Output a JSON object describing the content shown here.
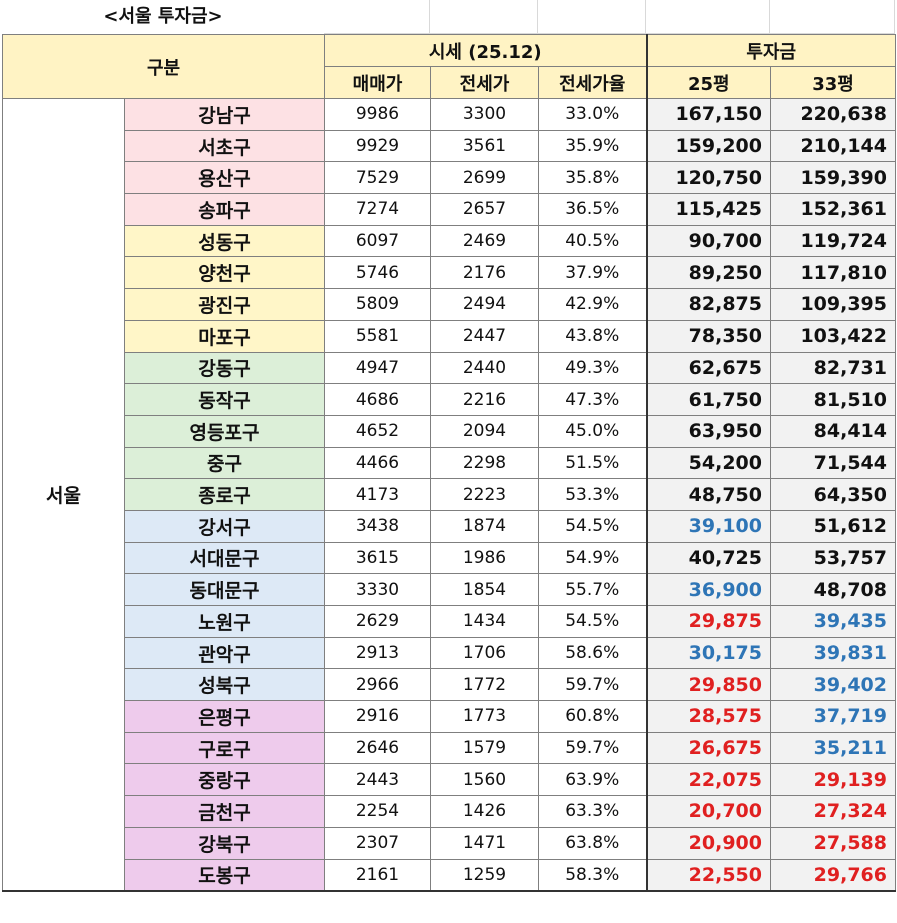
{
  "sheet_title": "<서울 투자금>",
  "header": {
    "category": "구분",
    "market_group": "시세 (25.12)",
    "investment_group": "투자금",
    "sale_price": "매매가",
    "jeonse_price": "전세가",
    "jeonse_ratio": "전세가율",
    "size_25": "25평",
    "size_33": "33평"
  },
  "region": "서울",
  "colors": {
    "pink": "#fde1e4",
    "yellow": "#fff6c8",
    "green": "#dcefd8",
    "blue": "#dde9f6",
    "purple": "#eecbec",
    "value_black": "#111111",
    "value_blue": "#2e75b6",
    "value_red": "#e02020"
  },
  "rows": [
    {
      "district": "강남구",
      "group": "pink",
      "sale": "9986",
      "jeonse": "3300",
      "ratio": "33.0%",
      "inv25": "167,150",
      "inv25_color": "black",
      "inv33": "220,638",
      "inv33_color": "black"
    },
    {
      "district": "서초구",
      "group": "pink",
      "sale": "9929",
      "jeonse": "3561",
      "ratio": "35.9%",
      "inv25": "159,200",
      "inv25_color": "black",
      "inv33": "210,144",
      "inv33_color": "black"
    },
    {
      "district": "용산구",
      "group": "pink",
      "sale": "7529",
      "jeonse": "2699",
      "ratio": "35.8%",
      "inv25": "120,750",
      "inv25_color": "black",
      "inv33": "159,390",
      "inv33_color": "black"
    },
    {
      "district": "송파구",
      "group": "pink",
      "sale": "7274",
      "jeonse": "2657",
      "ratio": "36.5%",
      "inv25": "115,425",
      "inv25_color": "black",
      "inv33": "152,361",
      "inv33_color": "black"
    },
    {
      "district": "성동구",
      "group": "yellow",
      "sale": "6097",
      "jeonse": "2469",
      "ratio": "40.5%",
      "inv25": "90,700",
      "inv25_color": "black",
      "inv33": "119,724",
      "inv33_color": "black"
    },
    {
      "district": "양천구",
      "group": "yellow",
      "sale": "5746",
      "jeonse": "2176",
      "ratio": "37.9%",
      "inv25": "89,250",
      "inv25_color": "black",
      "inv33": "117,810",
      "inv33_color": "black"
    },
    {
      "district": "광진구",
      "group": "yellow",
      "sale": "5809",
      "jeonse": "2494",
      "ratio": "42.9%",
      "inv25": "82,875",
      "inv25_color": "black",
      "inv33": "109,395",
      "inv33_color": "black"
    },
    {
      "district": "마포구",
      "group": "yellow",
      "sale": "5581",
      "jeonse": "2447",
      "ratio": "43.8%",
      "inv25": "78,350",
      "inv25_color": "black",
      "inv33": "103,422",
      "inv33_color": "black"
    },
    {
      "district": "강동구",
      "group": "green",
      "sale": "4947",
      "jeonse": "2440",
      "ratio": "49.3%",
      "inv25": "62,675",
      "inv25_color": "black",
      "inv33": "82,731",
      "inv33_color": "black"
    },
    {
      "district": "동작구",
      "group": "green",
      "sale": "4686",
      "jeonse": "2216",
      "ratio": "47.3%",
      "inv25": "61,750",
      "inv25_color": "black",
      "inv33": "81,510",
      "inv33_color": "black"
    },
    {
      "district": "영등포구",
      "group": "green",
      "sale": "4652",
      "jeonse": "2094",
      "ratio": "45.0%",
      "inv25": "63,950",
      "inv25_color": "black",
      "inv33": "84,414",
      "inv33_color": "black"
    },
    {
      "district": "중구",
      "group": "green",
      "sale": "4466",
      "jeonse": "2298",
      "ratio": "51.5%",
      "inv25": "54,200",
      "inv25_color": "black",
      "inv33": "71,544",
      "inv33_color": "black"
    },
    {
      "district": "종로구",
      "group": "green",
      "sale": "4173",
      "jeonse": "2223",
      "ratio": "53.3%",
      "inv25": "48,750",
      "inv25_color": "black",
      "inv33": "64,350",
      "inv33_color": "black"
    },
    {
      "district": "강서구",
      "group": "blue",
      "sale": "3438",
      "jeonse": "1874",
      "ratio": "54.5%",
      "inv25": "39,100",
      "inv25_color": "blue",
      "inv33": "51,612",
      "inv33_color": "black"
    },
    {
      "district": "서대문구",
      "group": "blue",
      "sale": "3615",
      "jeonse": "1986",
      "ratio": "54.9%",
      "inv25": "40,725",
      "inv25_color": "black",
      "inv33": "53,757",
      "inv33_color": "black"
    },
    {
      "district": "동대문구",
      "group": "blue",
      "sale": "3330",
      "jeonse": "1854",
      "ratio": "55.7%",
      "inv25": "36,900",
      "inv25_color": "blue",
      "inv33": "48,708",
      "inv33_color": "black"
    },
    {
      "district": "노원구",
      "group": "blue",
      "sale": "2629",
      "jeonse": "1434",
      "ratio": "54.5%",
      "inv25": "29,875",
      "inv25_color": "red",
      "inv33": "39,435",
      "inv33_color": "blue"
    },
    {
      "district": "관악구",
      "group": "blue",
      "sale": "2913",
      "jeonse": "1706",
      "ratio": "58.6%",
      "inv25": "30,175",
      "inv25_color": "blue",
      "inv33": "39,831",
      "inv33_color": "blue"
    },
    {
      "district": "성북구",
      "group": "blue",
      "sale": "2966",
      "jeonse": "1772",
      "ratio": "59.7%",
      "inv25": "29,850",
      "inv25_color": "red",
      "inv33": "39,402",
      "inv33_color": "blue"
    },
    {
      "district": "은평구",
      "group": "purple",
      "sale": "2916",
      "jeonse": "1773",
      "ratio": "60.8%",
      "inv25": "28,575",
      "inv25_color": "red",
      "inv33": "37,719",
      "inv33_color": "blue"
    },
    {
      "district": "구로구",
      "group": "purple",
      "sale": "2646",
      "jeonse": "1579",
      "ratio": "59.7%",
      "inv25": "26,675",
      "inv25_color": "red",
      "inv33": "35,211",
      "inv33_color": "blue"
    },
    {
      "district": "중랑구",
      "group": "purple",
      "sale": "2443",
      "jeonse": "1560",
      "ratio": "63.9%",
      "inv25": "22,075",
      "inv25_color": "red",
      "inv33": "29,139",
      "inv33_color": "red"
    },
    {
      "district": "금천구",
      "group": "purple",
      "sale": "2254",
      "jeonse": "1426",
      "ratio": "63.3%",
      "inv25": "20,700",
      "inv25_color": "red",
      "inv33": "27,324",
      "inv33_color": "red"
    },
    {
      "district": "강북구",
      "group": "purple",
      "sale": "2307",
      "jeonse": "1471",
      "ratio": "63.8%",
      "inv25": "20,900",
      "inv25_color": "red",
      "inv33": "27,588",
      "inv33_color": "red"
    },
    {
      "district": "도봉구",
      "group": "purple",
      "sale": "2161",
      "jeonse": "1259",
      "ratio": "58.3%",
      "inv25": "22,550",
      "inv25_color": "red",
      "inv33": "29,766",
      "inv33_color": "red"
    }
  ]
}
